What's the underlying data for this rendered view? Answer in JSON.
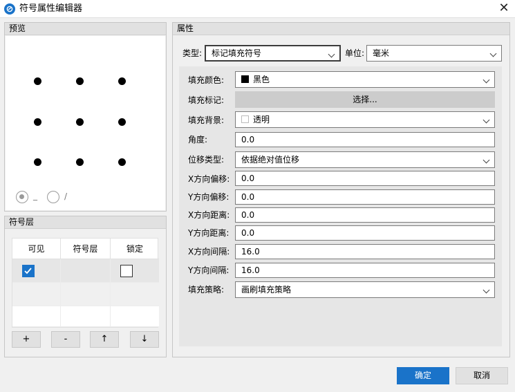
{
  "window": {
    "title": "符号属性编辑器",
    "icon": "app-logo-icon",
    "close": "✕"
  },
  "preview": {
    "header": "预览",
    "radio1_label": "_",
    "radio2_label": "/",
    "radio_selected": 1
  },
  "layers": {
    "header": "符号层",
    "columns": [
      "可见",
      "符号层",
      "锁定"
    ],
    "rows": [
      {
        "visible": true,
        "layer": "",
        "locked": false
      }
    ],
    "buttons": [
      "+",
      "-",
      "↑",
      "↓"
    ]
  },
  "properties": {
    "header": "属性",
    "type_label": "类型:",
    "type_value": "标记填充符号",
    "unit_label": "单位:",
    "unit_value": "毫米",
    "fields": {
      "fill_color_label": "填充颜色:",
      "fill_color_value": "黑色",
      "fill_color_swatch": "#000000",
      "fill_mark_label": "填充标记:",
      "fill_mark_button": "选择...",
      "fill_bg_label": "填充背景:",
      "fill_bg_value": "透明",
      "fill_bg_swatch": "#ffffff",
      "angle_label": "角度:",
      "angle_value": "0.0",
      "offset_type_label": "位移类型:",
      "offset_type_value": "依据绝对值位移",
      "x_offset_label": "X方向偏移:",
      "x_offset_value": "0.0",
      "y_offset_label": "Y方向偏移:",
      "y_offset_value": "0.0",
      "x_dist_label": "X方向距离:",
      "x_dist_value": "0.0",
      "y_dist_label": "Y方向距离:",
      "y_dist_value": "0.0",
      "x_gap_label": "X方向间隔:",
      "x_gap_value": "16.0",
      "y_gap_label": "Y方向间隔:",
      "y_gap_value": "16.0",
      "strategy_label": "填充策略:",
      "strategy_value": "画刷填充策略"
    }
  },
  "footer": {
    "ok": "确定",
    "cancel": "取消"
  },
  "colors": {
    "accent": "#1a73c9",
    "panel_bg": "#f0f0f0",
    "group_header": "#e1e1e1"
  }
}
